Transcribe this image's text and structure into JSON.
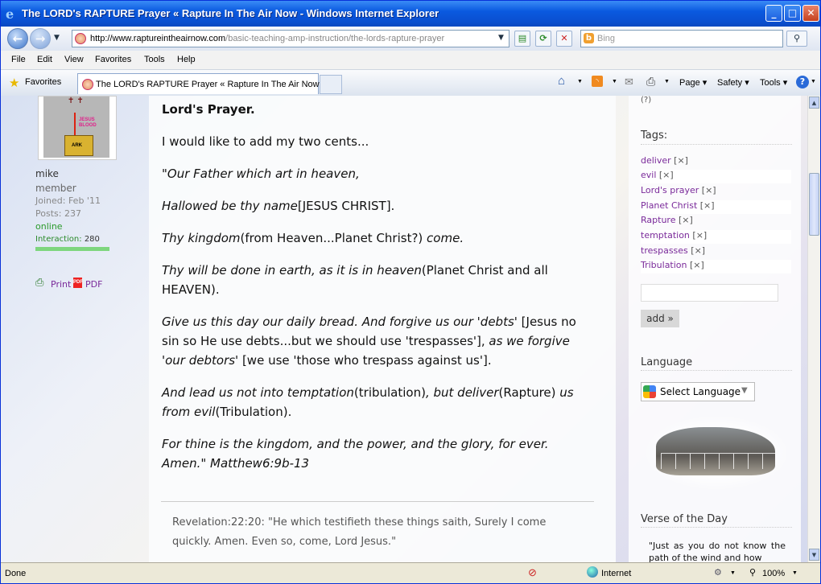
{
  "window": {
    "title": "The LORD's RAPTURE Prayer « Rapture In The Air Now - Windows Internet Explorer"
  },
  "address": {
    "host": "http://www.raptureintheairnow.com",
    "path": "/basic-teaching-amp-instruction/the-lords-rapture-prayer"
  },
  "search": {
    "placeholder": "Bing"
  },
  "menu": [
    "File",
    "Edit",
    "View",
    "Favorites",
    "Tools",
    "Help"
  ],
  "favbar": {
    "favorites": "Favorites",
    "tab": "The LORD's RAPTURE Prayer « Rapture In The Air Now",
    "page": "Page",
    "safety": "Safety",
    "tools": "Tools"
  },
  "user": {
    "name": "mike",
    "role": "member",
    "joined": "Joined: Feb '11",
    "posts": "Posts: 237",
    "status": "online",
    "interaction": "Interaction:",
    "interaction_value": "280",
    "print": "Print",
    "pdf": "PDF"
  },
  "avatar": {
    "blood": "JESUS BLOOD",
    "ark": "ARK"
  },
  "post": {
    "heading": "Lord's Prayer",
    "intro": "I would like to add my two cents...",
    "l1": "\"Our Father which art in heaven,",
    "l2a": "Hallowed be thy name",
    "l2b": "[JESUS CHRIST].",
    "l3a": "Thy kingdom",
    "l3b": "(from Heaven...Planet Christ?)",
    "l3c": " come.",
    "l4a": "Thy will be done in earth, as it is in heaven",
    "l4b": "(Planet Christ and all HEAVEN).",
    "l5a": "Give us this day our daily bread. And forgive us our 'debts' ",
    "l5b": "[Jesus no sin so He use debts...but we should use 'trespasses'],",
    "l5c": " as we forgive 'our debtors'",
    "l5d": " [we use 'those who trespass against us'].",
    "l6a": " And lead us not into temptation",
    "l6b": "(tribulation)",
    "l6c": ", but deliver",
    "l6d": "(Rapture)",
    "l6e": " us from evil",
    "l6f": "(Tribulation).",
    "l7": "For thine is the kingdom, and the power, and the glory, for ever. Amen.\"  Matthew6:9b-13",
    "quote": "Revelation:22:20: \"He which testifieth these things saith, Surely I come quickly. Amen. Even so, come, Lord Jesus.\""
  },
  "sidebar": {
    "top": "(?)",
    "tags_title": "Tags:",
    "tags": [
      "deliver",
      "evil",
      "Lord's prayer",
      "Planet Christ",
      "Rapture",
      "temptation",
      "trespasses",
      "Tribulation"
    ],
    "x": "[×]",
    "add": "add »",
    "language_title": "Language",
    "select_language": "Select Language",
    "verse_title": "Verse of the Day",
    "verse_text": "\"Just as you do not know the path of the wind and how"
  },
  "status": {
    "left": "Done",
    "zone": "Internet",
    "zoom": "100%"
  },
  "colors": {
    "accent": "#0a5ae0",
    "tag": "#7a2a9a",
    "online": "#2a9a2a"
  }
}
